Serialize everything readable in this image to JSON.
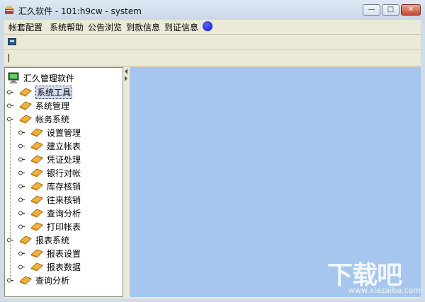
{
  "window": {
    "title": "汇久软件 - 101:h9cw - system",
    "min_label": "—",
    "max_label": "□",
    "close_label": "✕"
  },
  "menu": {
    "items": [
      "帐套配置",
      "系统帮助",
      "公告浏览",
      "到款信息",
      "到证信息"
    ]
  },
  "tree": {
    "root": "汇久管理软件",
    "nodes": [
      {
        "label": "系统工具",
        "level": 1,
        "selected": true
      },
      {
        "label": "系统管理",
        "level": 1
      },
      {
        "label": "帐务系统",
        "level": 1,
        "expanded": true
      },
      {
        "label": "设置管理",
        "level": 2
      },
      {
        "label": "建立帐表",
        "level": 2
      },
      {
        "label": "凭证处理",
        "level": 2
      },
      {
        "label": "银行对帐",
        "level": 2
      },
      {
        "label": "库存核销",
        "level": 2
      },
      {
        "label": "往来核销",
        "level": 2
      },
      {
        "label": "查询分析",
        "level": 2
      },
      {
        "label": "打印帐表",
        "level": 2
      },
      {
        "label": "报表系统",
        "level": 1,
        "expanded": true
      },
      {
        "label": "报表设置",
        "level": 2
      },
      {
        "label": "报表数据",
        "level": 2
      },
      {
        "label": "查询分析",
        "level": 1
      }
    ]
  },
  "watermark": {
    "main": "下载吧",
    "sub": "www.xiazaiba.com"
  },
  "colors": {
    "content_bg": "#a6c6ed",
    "frame_bg": "#ece9d8",
    "menu_dot": "#0a10d8"
  }
}
